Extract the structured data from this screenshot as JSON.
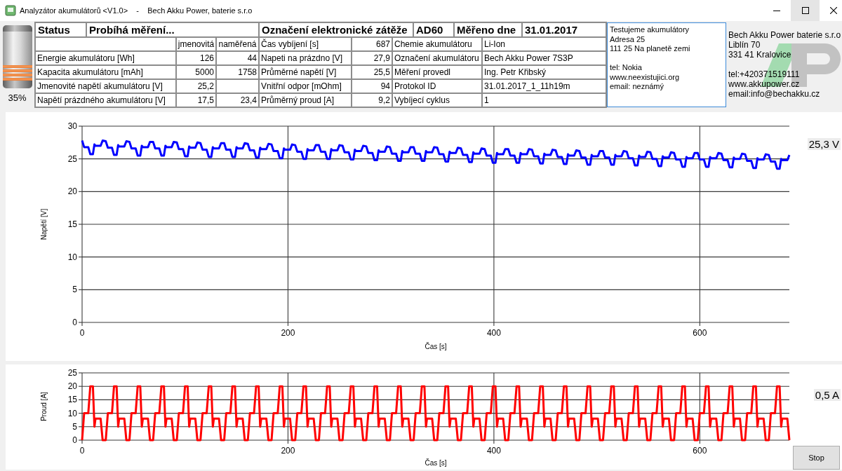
{
  "window": {
    "title": "Analyzátor akumulátorů <V1.0>    -    Bech Akku Power, baterie s.r.o",
    "controls": [
      {
        "kind": "minimize",
        "hovered": false
      },
      {
        "kind": "maximize",
        "hovered": true
      },
      {
        "kind": "close",
        "hovered": false
      }
    ]
  },
  "battery": {
    "level": 0.35,
    "percent": "35%"
  },
  "status": {
    "label": "Status",
    "value": "Probíhá měření..."
  },
  "load": {
    "label": "Označení elektronické zátěže",
    "value": "AD60"
  },
  "date": {
    "label": "Měřeno dne",
    "value": "31.01.2017"
  },
  "parameters": {
    "columns": [
      "jmenovitá",
      "naměřená"
    ],
    "rows": [
      {
        "label": "Energie akumulátoru [Wh]",
        "nominal": "126",
        "measured": "44"
      },
      {
        "label": "Kapacita akumulátoru [mAh]",
        "nominal": "5000",
        "measured": "1758"
      },
      {
        "label": "Jmenovité napětí akumulátoru [V]",
        "nominal": "25,2"
      },
      {
        "label": "Napětí prázdného akumulátoru [V]",
        "nominal": "17,5",
        "measured": "23,4"
      }
    ]
  },
  "readings": [
    {
      "label": "Čas vybíjení [s]",
      "value": "687"
    },
    {
      "label": "Napeti na prázdno [V]",
      "value": "27,9"
    },
    {
      "label": "Průměrné napětí [V]",
      "value": "25,5"
    },
    {
      "label": "Vnitřní odpor [mOhm]",
      "value": "94"
    },
    {
      "label": "Průměrný proud [A]",
      "value": "9,2"
    }
  ],
  "battery_info": [
    {
      "label": "Chemie akumulátoru",
      "value": "Li-Ion"
    },
    {
      "label": "Označení akumulátoru",
      "value": "Bech Akku Power 7S3P"
    },
    {
      "label": "Měření provedl",
      "value": "Ing. Petr Křibský"
    },
    {
      "label": "Protokol ID",
      "value": "31.01.2017_1_11h19m"
    },
    {
      "label": "Vybíjecí cyklus",
      "value": "1"
    }
  ],
  "tester": {
    "address": [
      "Testujeme akumulátory",
      "Adresa 25",
      "111 25 Na planetě zemi"
    ],
    "contacts": [
      "tel: Nokia",
      "www.neexistujici.org",
      "email: neznámý"
    ]
  },
  "company": {
    "address": [
      "Bech Akku Power baterie s.r.o",
      "Liblín 70",
      "331 41 Kralovice"
    ],
    "contacts": [
      "tel:+420371519111",
      "www.akkupower.cz",
      "email:info@bechakku.cz"
    ]
  },
  "voltage_panel": {
    "readout": "25,3 V",
    "chart_data": {
      "type": "line",
      "grid": true,
      "xlabel": "Čas [s]",
      "ylabel": "Napětí [V]",
      "x": [
        0,
        2,
        6,
        8,
        10.5,
        12,
        13,
        18,
        20,
        23,
        25,
        29,
        31,
        33.5,
        35,
        36,
        41,
        43,
        46,
        48,
        52,
        54,
        56.5,
        58,
        59,
        64,
        66,
        69,
        71,
        75,
        77,
        79.5,
        81,
        82,
        87,
        89,
        92,
        94,
        98,
        100,
        102.5,
        104,
        105,
        110,
        112,
        115,
        117,
        121,
        123,
        125.5,
        127,
        128,
        133,
        135,
        138,
        140,
        144,
        146,
        148.5,
        150,
        151,
        156,
        158,
        161,
        163,
        167,
        169,
        171.5,
        173,
        174,
        179,
        181,
        184,
        186,
        190,
        192,
        194.5,
        196,
        197,
        202,
        204,
        207,
        209,
        213,
        215,
        217.5,
        219,
        220,
        225,
        227,
        230,
        232,
        236,
        238,
        240.5,
        242,
        243,
        248,
        250,
        253,
        255,
        259,
        261,
        263.5,
        265,
        266,
        271,
        273,
        276,
        278,
        282,
        284,
        286.5,
        288,
        289,
        294,
        296,
        299,
        301,
        305,
        307,
        309.5,
        311,
        312,
        317,
        319,
        322,
        324,
        328,
        330,
        332.5,
        334,
        335,
        340,
        342,
        345,
        347,
        351,
        353,
        355.5,
        357,
        358,
        363,
        365,
        368,
        370,
        374,
        376,
        378.5,
        380,
        381,
        386,
        388,
        391,
        393,
        397,
        399,
        401.5,
        403,
        404,
        409,
        411,
        414,
        416,
        420,
        422,
        424.5,
        426,
        427,
        432,
        434,
        437,
        439,
        443,
        445,
        447.5,
        449,
        450,
        455,
        457,
        460,
        462,
        466,
        468,
        470.5,
        472,
        473,
        478,
        480,
        483,
        485,
        489,
        491,
        493.5,
        495,
        496,
        501,
        503,
        506,
        508,
        512,
        514,
        516.5,
        518,
        519,
        524,
        526,
        529,
        531,
        535,
        537,
        539.5,
        541,
        542,
        547,
        549,
        552,
        554,
        558,
        560,
        562.5,
        564,
        565,
        570,
        572,
        575,
        577,
        581,
        583,
        585.5,
        587,
        588,
        593,
        595,
        598,
        600,
        604,
        606,
        608.5,
        610,
        611,
        616,
        618,
        621,
        623,
        627,
        629,
        631.5,
        633,
        634,
        639,
        641,
        644,
        646,
        650,
        652,
        654.5,
        656,
        657,
        662,
        664,
        667,
        669,
        673,
        675,
        677.5,
        679,
        680,
        685,
        687
      ],
      "series": [
        {
          "color": "#0000ff",
          "values": [
            27.8,
            26.8,
            26.8,
            25.7,
            25.7,
            27.2,
            27,
            27,
            27.8,
            27.7,
            26.7,
            26.7,
            25.6,
            25.6,
            27.1,
            26.9,
            26.9,
            27.7,
            27.6,
            26.6,
            26.6,
            25.5,
            25.5,
            27,
            26.8,
            26.8,
            27.6,
            27.6,
            26.6,
            26.6,
            25.5,
            25.5,
            27,
            26.8,
            26.8,
            27.6,
            27.5,
            26.5,
            26.5,
            25.4,
            25.4,
            26.9,
            26.7,
            26.7,
            27.5,
            27.4,
            26.4,
            26.4,
            25.3,
            25.3,
            26.8,
            26.6,
            26.6,
            27.4,
            27.4,
            26.4,
            26.4,
            25.3,
            25.3,
            26.8,
            26.6,
            26.6,
            27.4,
            27.3,
            26.3,
            26.3,
            25.2,
            25.2,
            26.7,
            26.5,
            26.5,
            27.3,
            27.2,
            26.2,
            26.2,
            25.1,
            25.1,
            26.6,
            26.4,
            26.4,
            27.2,
            27.1,
            26.1,
            26.1,
            25,
            25,
            26.5,
            26.3,
            26.3,
            27.1,
            27.1,
            26.1,
            26.1,
            25,
            25,
            26.5,
            26.3,
            26.3,
            27.1,
            27,
            26,
            26,
            24.9,
            24.9,
            26.4,
            26.2,
            26.2,
            27,
            26.9,
            25.9,
            25.9,
            24.8,
            24.8,
            26.3,
            26.1,
            26.1,
            26.9,
            26.8,
            25.8,
            25.8,
            24.7,
            24.7,
            26.2,
            26,
            26,
            26.8,
            26.8,
            25.8,
            25.8,
            24.7,
            24.7,
            26.2,
            26,
            26,
            26.8,
            26.7,
            25.7,
            25.7,
            24.6,
            24.6,
            26.1,
            25.9,
            25.9,
            26.7,
            26.6,
            25.6,
            25.6,
            24.5,
            24.5,
            26,
            25.8,
            25.8,
            26.6,
            26.5,
            25.5,
            25.5,
            24.4,
            24.4,
            25.9,
            25.7,
            25.7,
            26.5,
            26.5,
            25.5,
            25.5,
            24.4,
            24.4,
            25.9,
            25.7,
            25.7,
            26.5,
            26.4,
            25.4,
            25.4,
            24.3,
            24.3,
            25.8,
            25.6,
            25.6,
            26.4,
            26.3,
            25.3,
            25.3,
            24.2,
            24.2,
            25.7,
            25.5,
            25.5,
            26.3,
            26.2,
            25.2,
            25.2,
            24.1,
            24.1,
            25.6,
            25.4,
            25.4,
            26.2,
            26.2,
            25.2,
            25.2,
            24.1,
            24.1,
            25.6,
            25.4,
            25.4,
            26.2,
            26.1,
            25.1,
            25.1,
            24,
            24,
            25.5,
            25.3,
            25.3,
            26.1,
            26,
            25,
            25,
            23.9,
            23.9,
            25.4,
            25.2,
            25.2,
            26,
            25.9,
            24.9,
            24.9,
            23.8,
            23.8,
            25.3,
            25.1,
            25.1,
            25.9,
            25.9,
            24.9,
            24.9,
            23.8,
            23.8,
            25.3,
            25.1,
            25.1,
            25.9,
            25.8,
            24.8,
            24.8,
            23.7,
            23.7,
            25.2,
            25,
            25,
            25.8,
            25.7,
            24.7,
            24.7,
            23.6,
            23.6,
            25.1,
            24.9,
            24.9,
            25.7,
            25.6,
            24.6,
            24.6,
            23.5,
            23.5,
            25,
            24.8,
            24.8,
            25.6
          ]
        }
      ],
      "xlim": [
        0,
        687
      ],
      "ylim": [
        0,
        30
      ],
      "xticks": [
        0,
        200,
        400,
        600
      ],
      "yticks": [
        0,
        5,
        10,
        15,
        20,
        25,
        30
      ]
    }
  },
  "current_panel": {
    "readout": "0,5 A",
    "chart_data": {
      "type": "line",
      "grid": true,
      "xlabel": "Čas [s]",
      "ylabel": "Proud [A]",
      "x": [
        0,
        2,
        6,
        8,
        10.5,
        12,
        13,
        18,
        20,
        23,
        25,
        29,
        31,
        33.5,
        35,
        36,
        41,
        43,
        46,
        48,
        52,
        54,
        56.5,
        58,
        59,
        64,
        66,
        69,
        71,
        75,
        77,
        79.5,
        81,
        82,
        87,
        89,
        92,
        94,
        98,
        100,
        102.5,
        104,
        105,
        110,
        112,
        115,
        117,
        121,
        123,
        125.5,
        127,
        128,
        133,
        135,
        138,
        140,
        144,
        146,
        148.5,
        150,
        151,
        156,
        158,
        161,
        163,
        167,
        169,
        171.5,
        173,
        174,
        179,
        181,
        184,
        186,
        190,
        192,
        194.5,
        196,
        197,
        202,
        204,
        207,
        209,
        213,
        215,
        217.5,
        219,
        220,
        225,
        227,
        230,
        232,
        236,
        238,
        240.5,
        242,
        243,
        248,
        250,
        253,
        255,
        259,
        261,
        263.5,
        265,
        266,
        271,
        273,
        276,
        278,
        282,
        284,
        286.5,
        288,
        289,
        294,
        296,
        299,
        301,
        305,
        307,
        309.5,
        311,
        312,
        317,
        319,
        322,
        324,
        328,
        330,
        332.5,
        334,
        335,
        340,
        342,
        345,
        347,
        351,
        353,
        355.5,
        357,
        358,
        363,
        365,
        368,
        370,
        374,
        376,
        378.5,
        380,
        381,
        386,
        388,
        391,
        393,
        397,
        399,
        401.5,
        403,
        404,
        409,
        411,
        414,
        416,
        420,
        422,
        424.5,
        426,
        427,
        432,
        434,
        437,
        439,
        443,
        445,
        447.5,
        449,
        450,
        455,
        457,
        460,
        462,
        466,
        468,
        470.5,
        472,
        473,
        478,
        480,
        483,
        485,
        489,
        491,
        493.5,
        495,
        496,
        501,
        503,
        506,
        508,
        512,
        514,
        516.5,
        518,
        519,
        524,
        526,
        529,
        531,
        535,
        537,
        539.5,
        541,
        542,
        547,
        549,
        552,
        554,
        558,
        560,
        562.5,
        564,
        565,
        570,
        572,
        575,
        577,
        581,
        583,
        585.5,
        587,
        588,
        593,
        595,
        598,
        600,
        604,
        606,
        608.5,
        610,
        611,
        616,
        618,
        621,
        623,
        627,
        629,
        631.5,
        633,
        634,
        639,
        641,
        644,
        646,
        650,
        652,
        654.5,
        656,
        657,
        662,
        664,
        667,
        669,
        673,
        675,
        677.5,
        679,
        680,
        685,
        687
      ],
      "series": [
        {
          "color": "#ff0000",
          "values": [
            0,
            10,
            10,
            20,
            20,
            5,
            8,
            8,
            0,
            0,
            10,
            10,
            20,
            20,
            5,
            8,
            8,
            0,
            0,
            10,
            10,
            20,
            20,
            5,
            8,
            8,
            0,
            0,
            10,
            10,
            20,
            20,
            5,
            8,
            8,
            0,
            0,
            10,
            10,
            20,
            20,
            5,
            8,
            8,
            0,
            0,
            10,
            10,
            20,
            20,
            5,
            8,
            8,
            0,
            0,
            10,
            10,
            20,
            20,
            5,
            8,
            8,
            0,
            0,
            10,
            10,
            20,
            20,
            5,
            8,
            8,
            0,
            0,
            10,
            10,
            20,
            20,
            5,
            8,
            8,
            0,
            0,
            10,
            10,
            20,
            20,
            5,
            8,
            8,
            0,
            0,
            10,
            10,
            20,
            20,
            5,
            8,
            8,
            0,
            0,
            10,
            10,
            20,
            20,
            5,
            8,
            8,
            0,
            0,
            10,
            10,
            20,
            20,
            5,
            8,
            8,
            0,
            0,
            10,
            10,
            20,
            20,
            5,
            8,
            8,
            0,
            0,
            10,
            10,
            20,
            20,
            5,
            8,
            8,
            0,
            0,
            10,
            10,
            20,
            20,
            5,
            8,
            8,
            0,
            0,
            10,
            10,
            20,
            20,
            5,
            8,
            8,
            0,
            0,
            10,
            10,
            20,
            20,
            5,
            8,
            8,
            0,
            0,
            10,
            10,
            20,
            20,
            5,
            8,
            8,
            0,
            0,
            10,
            10,
            20,
            20,
            5,
            8,
            8,
            0,
            0,
            10,
            10,
            20,
            20,
            5,
            8,
            8,
            0,
            0,
            10,
            10,
            20,
            20,
            5,
            8,
            8,
            0,
            0,
            10,
            10,
            20,
            20,
            5,
            8,
            8,
            0,
            0,
            10,
            10,
            20,
            20,
            5,
            8,
            8,
            0,
            0,
            10,
            10,
            20,
            20,
            5,
            8,
            8,
            0,
            0,
            10,
            10,
            20,
            20,
            5,
            8,
            8,
            0,
            0,
            10,
            10,
            20,
            20,
            5,
            8,
            8,
            0,
            0,
            10,
            10,
            20,
            20,
            5,
            8,
            8,
            0,
            0,
            10,
            10,
            20,
            20,
            5,
            8,
            8,
            0,
            0,
            10,
            10,
            20,
            20,
            5,
            8,
            8,
            0
          ]
        }
      ],
      "xlim": [
        0,
        687
      ],
      "ylim": [
        0,
        25
      ],
      "xticks": [
        0,
        200,
        400,
        600
      ],
      "yticks": [
        0,
        5,
        10,
        15,
        20,
        25
      ]
    }
  },
  "stop_button": {
    "label": "Stop"
  }
}
